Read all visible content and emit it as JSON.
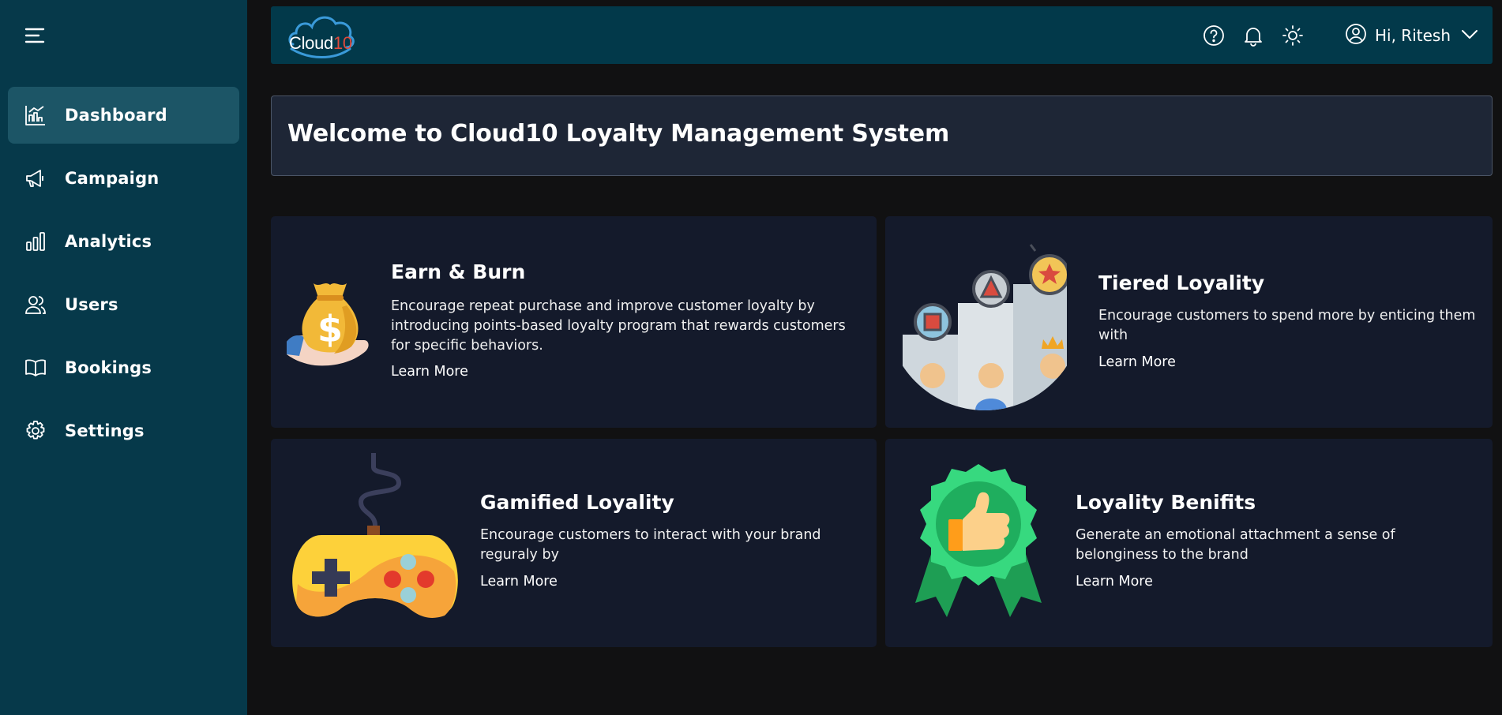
{
  "brand": {
    "logo_main": "Cloud",
    "logo_accent": "10"
  },
  "sidebar": {
    "items": [
      {
        "label": "Dashboard",
        "icon": "dashboard-chart-icon",
        "active": true
      },
      {
        "label": "Campaign",
        "icon": "megaphone-icon"
      },
      {
        "label": "Analytics",
        "icon": "bar-chart-icon"
      },
      {
        "label": "Users",
        "icon": "users-icon"
      },
      {
        "label": "Bookings",
        "icon": "book-icon"
      },
      {
        "label": "Settings",
        "icon": "gear-icon"
      }
    ]
  },
  "header": {
    "user_greeting": "Hi, Ritesh"
  },
  "welcome": {
    "title": "Welcome to Cloud10 Loyalty Management System"
  },
  "cards": [
    {
      "title": "Earn & Burn",
      "description": "Encourage repeat purchase and improve customer loyalty by introducing points-based loyalty program that rewards customers for specific behaviors.",
      "link": "Learn More",
      "icon": "money-bag-icon"
    },
    {
      "title": "Tiered Loyality",
      "description": "Encourage customers to spend more by enticing them with",
      "link": "Learn More",
      "icon": "podium-icon"
    },
    {
      "title": "Gamified Loyality",
      "description": "Encourage customers to interact with your brand reguraly by",
      "link": "Learn More",
      "icon": "gamepad-icon"
    },
    {
      "title": "Loyality Benifits",
      "description": "Generate an emotional attachment a sense of belonginess to the brand",
      "link": "Learn More",
      "icon": "award-badge-icon"
    }
  ],
  "colors": {
    "sidebar": "#06394a",
    "active_nav": "#1c5566",
    "topbar": "#02394a",
    "card": "#141a2b",
    "background": "#111112",
    "logo_accent": "#e04a3c"
  }
}
